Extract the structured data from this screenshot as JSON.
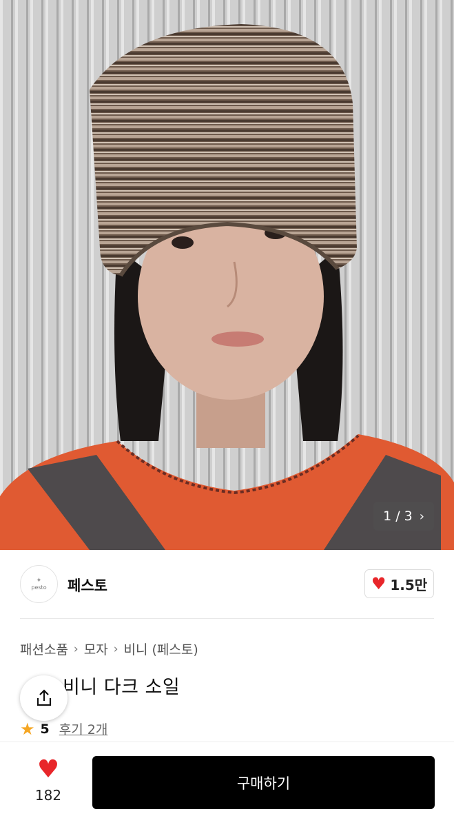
{
  "gallery": {
    "current": "1",
    "separator": "/",
    "total": "3",
    "next_icon": "chevron-right-icon"
  },
  "seller": {
    "logo_text": "pesto",
    "name": "페스토",
    "likes": "1.5만"
  },
  "breadcrumb": [
    "패션소품",
    "모자",
    "비니 (페스토)"
  ],
  "product": {
    "title_visible": "비니 다크 소일",
    "rating": "5",
    "reviews": "후기 2개"
  },
  "bottom": {
    "like_count": "182",
    "buy_label": "구매하기"
  },
  "colors": {
    "heart": "#e8262a",
    "star": "#f5a623",
    "buy_button": "#000000"
  }
}
